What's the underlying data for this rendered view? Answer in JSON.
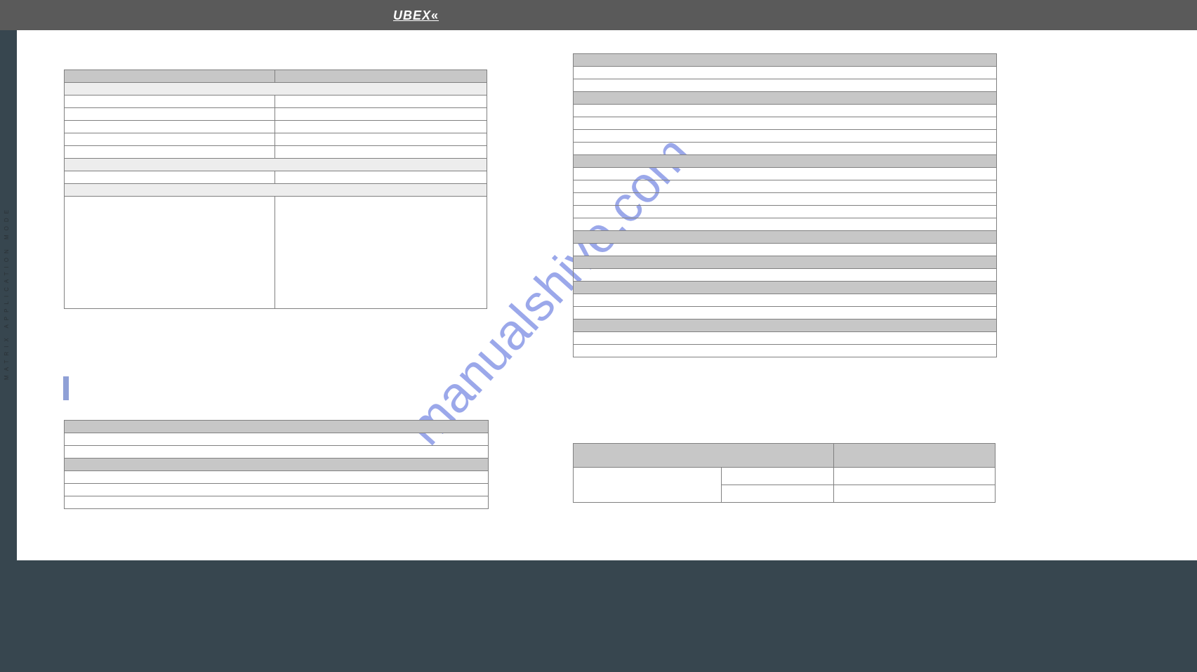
{
  "header": {
    "logo_text": "UBEX",
    "logo_suffix": "«"
  },
  "side_label": "MATRIX  APPLICATION  MODE",
  "watermark": "manualshive.com",
  "table1": {
    "h1": "",
    "h2": "",
    "sub1": "",
    "r1a": "",
    "r1b": "",
    "r2a": "",
    "r2b": "",
    "r3a": "",
    "r3b": "",
    "r4a": "",
    "r4b": "",
    "r5a": "",
    "r5b": "",
    "sub2": "",
    "r6a": "",
    "r6b": "",
    "sub3": "",
    "r7a": "",
    "r7b": ""
  },
  "table2": {
    "h": "",
    "r1": "",
    "r2": "",
    "sub": "",
    "r3": "",
    "r4": "",
    "r5": ""
  },
  "table3": {
    "h1": "",
    "r1": "",
    "r2": "",
    "h2": "",
    "r3": "",
    "r4": "",
    "r5": "",
    "r6": "",
    "h3": "",
    "r7": "",
    "r8": "",
    "r9": "",
    "r10": "",
    "r11": "",
    "h4": "",
    "r12": "",
    "h5": "",
    "r13": "",
    "h6": "",
    "r14": "",
    "r15": "",
    "h7": "",
    "r16": "",
    "r17": ""
  },
  "table4": {
    "h1": "",
    "h2": "",
    "r1a": "",
    "r1b": "",
    "r1c": "",
    "r2b": "",
    "r2c": ""
  }
}
